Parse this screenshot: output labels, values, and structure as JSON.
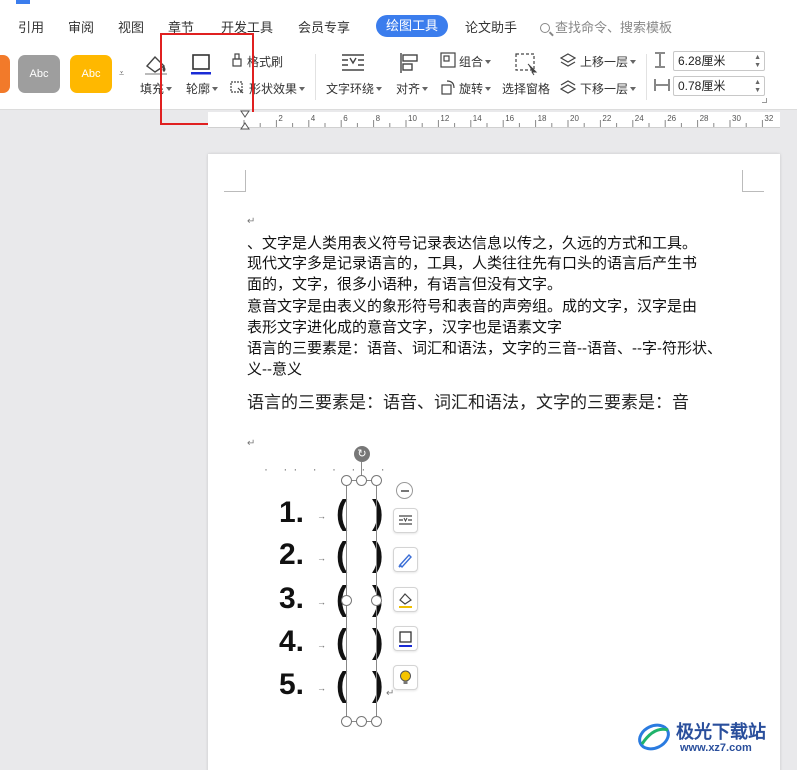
{
  "menu": {
    "items": [
      "引用",
      "审阅",
      "视图",
      "章节",
      "开发工具",
      "会员专享"
    ],
    "active": "绘图工具",
    "extra": "论文助手",
    "search_placeholder": "查找命令、搜索模板"
  },
  "ribbon": {
    "styles": [
      {
        "label": "Abc",
        "color": "#9e9e9e"
      },
      {
        "label": "Abc",
        "color": "#ffb800"
      }
    ],
    "fill_label": "填充",
    "outline_label": "轮廓",
    "format_brush": "格式刷",
    "shape_effect": "形状效果",
    "text_wrap": "文字环绕",
    "align": "对齐",
    "group": "组合",
    "rotate": "旋转",
    "selection_pane": "选择窗格",
    "bring_forward": "上移一层",
    "send_backward": "下移一层",
    "height_value": "6.28厘米",
    "width_value": "0.78厘米"
  },
  "ruler": {
    "labels": [
      "2",
      "4",
      "6",
      "8",
      "10",
      "12",
      "14",
      "16",
      "18",
      "20",
      "22",
      "24",
      "26",
      "28",
      "30",
      "32"
    ]
  },
  "document": {
    "lines": [
      "、文字是人类用表义符号记录表达信息以传之，久远的方式和工具。",
      "现代文字多是记录语言的，工具，人类往往先有口头的语言后产生书",
      "面的，文字，很多小语种，有语言但没有文字。",
      "意音文字是由表义的象形符号和表音的声旁组。成的文字，汉字是由",
      "表形文字进化成的意音文字，汉字也是语素文字",
      "语言的三要素是：语音、词汇和语法，文字的三音--语音、--字-符形状、",
      "义--意义"
    ],
    "serif_line": "语言的三要素是：语音、词汇和语法，文字的三要素是：音",
    "list_numbers": [
      "1.",
      "2.",
      "3.",
      "4.",
      "5."
    ]
  },
  "watermark": {
    "title": "极光下载站",
    "url": "www.xz7.com"
  }
}
